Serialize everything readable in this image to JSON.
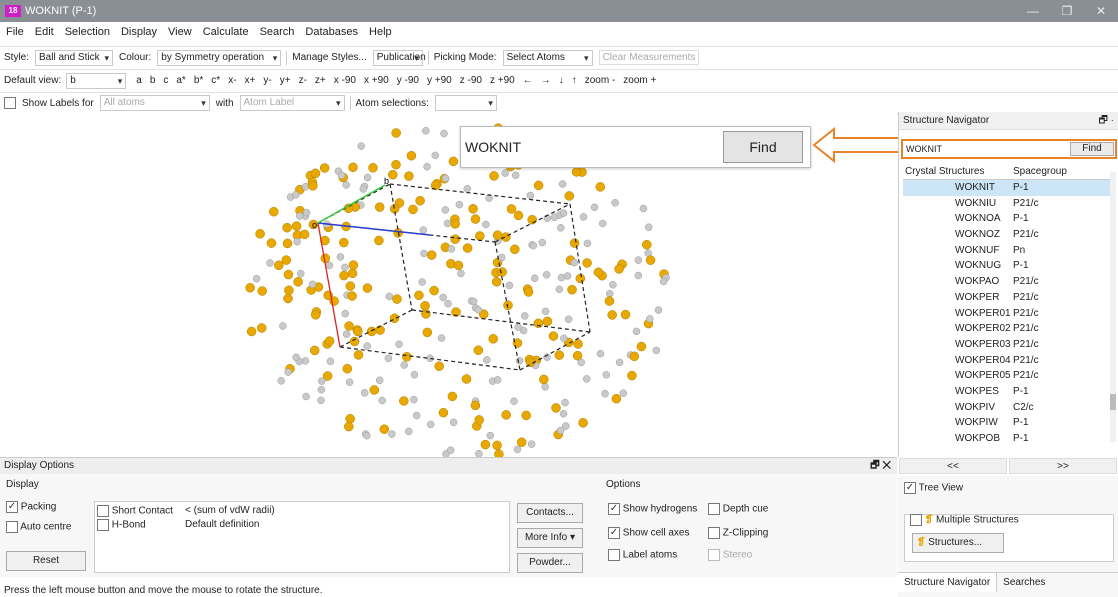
{
  "window": {
    "title": "WOKNIT (P-1)",
    "logo": "18",
    "minimize": "—",
    "restore": "❐",
    "close": "✕"
  },
  "menu": [
    "File",
    "Edit",
    "Selection",
    "Display",
    "View",
    "Calculate",
    "Search",
    "Databases",
    "Help"
  ],
  "toolbar1": {
    "style_label": "Style:",
    "style_value": "Ball and Stick",
    "colour_label": "Colour:",
    "colour_value": "by Symmetry operation",
    "manage": "Manage Styles...",
    "publication": "Publication",
    "picking_label": "Picking Mode:",
    "picking_value": "Select Atoms",
    "clear": "Clear Measurements"
  },
  "toolbar2": {
    "default_view_label": "Default view:",
    "default_view_value": "b",
    "views": [
      "a",
      "b",
      "c",
      "a*",
      "b*",
      "c*",
      "x-",
      "x+",
      "y-",
      "y+",
      "z-",
      "z+",
      "x -90",
      "x +90",
      "y -90",
      "y +90",
      "z -90",
      "z +90",
      "←",
      "→",
      "↓",
      "↑",
      "zoom -",
      "zoom +"
    ]
  },
  "toolbar3": {
    "show_labels": "Show Labels for",
    "all_atoms": "All atoms",
    "with": "with",
    "atom_label": "Atom Label",
    "atom_selections": "Atom selections:"
  },
  "find_overlay": {
    "query": "WOKNIT",
    "button": "Find"
  },
  "navigator": {
    "title": "Structure Navigator",
    "pin": "🗗 ·",
    "query": "WOKNIT",
    "find": "Find",
    "col1": "Crystal Structures",
    "col2": "Spacegroup",
    "rows": [
      [
        "WOKNIT",
        "P-1"
      ],
      [
        "WOKNIU",
        "P21/c"
      ],
      [
        "WOKNOA",
        "P-1"
      ],
      [
        "WOKNOZ",
        "P21/c"
      ],
      [
        "WOKNUF",
        "Pn"
      ],
      [
        "WOKNUG",
        "P-1"
      ],
      [
        "WOKPAO",
        "P21/c"
      ],
      [
        "WOKPER",
        "P21/c"
      ],
      [
        "WOKPER01",
        "P21/c"
      ],
      [
        "WOKPER02",
        "P21/c"
      ],
      [
        "WOKPER03",
        "P21/c"
      ],
      [
        "WOKPER04",
        "P21/c"
      ],
      [
        "WOKPER05",
        "P21/c"
      ],
      [
        "WOKPES",
        "P-1"
      ],
      [
        "WOKPIV",
        "C2/c"
      ],
      [
        "WOKPIW",
        "P-1"
      ],
      [
        "WOKPOB",
        "P-1"
      ]
    ],
    "prev": "<<",
    "next": ">>",
    "tree_view": "Tree View",
    "multiple": "Multiple Structures",
    "structures": "Structures...",
    "tab1": "Structure Navigator",
    "tab2": "Searches"
  },
  "display_options": {
    "title": "Display Options",
    "pin": "🗗 ✕",
    "display": "Display",
    "packing": "Packing",
    "auto_centre": "Auto centre",
    "reset": "Reset",
    "short_contact": "Short Contact",
    "short_def": "< (sum of vdW radii)",
    "hbond": "H-Bond",
    "hbond_def": "Default definition",
    "contacts": "Contacts...",
    "more_info": "More Info ▾",
    "powder": "Powder...",
    "options": "Options",
    "show_h": "Show hydrogens",
    "depth_cue": "Depth cue",
    "cell_axes": "Show cell axes",
    "z_clip": "Z-Clipping",
    "label_atoms": "Label atoms",
    "stereo": "Stereo"
  },
  "status": "Press the left mouse button and move the mouse to rotate the structure.",
  "colors": {
    "sulfur": "#e8a800",
    "carbon": "#c9c9c9",
    "accent": "#e8832a"
  }
}
